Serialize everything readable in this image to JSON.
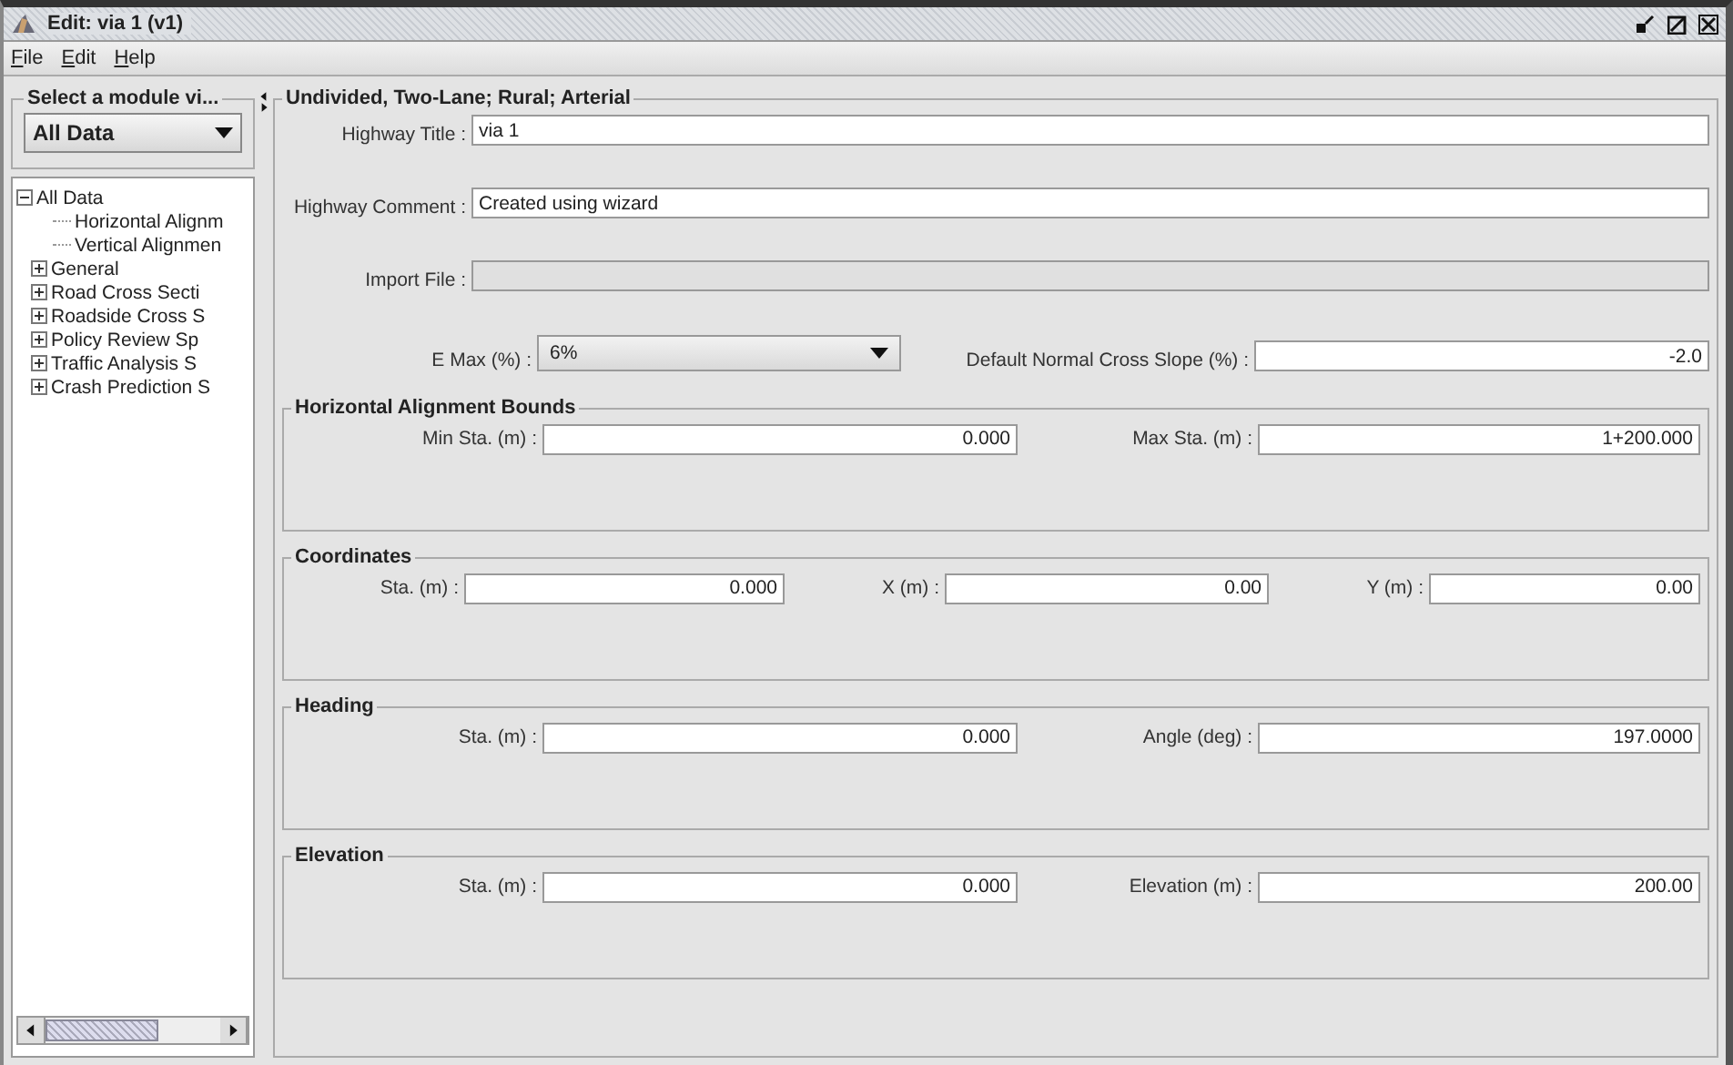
{
  "window": {
    "title": "Edit: via 1 (v1)"
  },
  "menu": [
    "File",
    "Edit",
    "Help"
  ],
  "module_selector": {
    "title": "Select a module vi...",
    "value": "All Data"
  },
  "tree": [
    {
      "label": "All Data",
      "expanded": true,
      "children": [
        {
          "label": "Horizontal Alignm"
        },
        {
          "label": "Vertical Alignmen"
        },
        {
          "label": "General",
          "expanded": false
        },
        {
          "label": "Road Cross Secti",
          "expanded": false
        },
        {
          "label": "Roadside Cross S",
          "expanded": false
        },
        {
          "label": "Policy Review Sp",
          "expanded": false
        },
        {
          "label": "Traffic Analysis S",
          "expanded": false
        },
        {
          "label": "Crash Prediction S",
          "expanded": false
        }
      ]
    }
  ],
  "highway": {
    "title": "Undivided, Two-Lane; Rural; Arterial",
    "fields": [
      {
        "label": "Highway Title :",
        "value": "via 1",
        "disabled": false
      },
      {
        "label": "Highway Comment :",
        "value": "Created using wizard",
        "disabled": false
      },
      {
        "label": "Import File :",
        "disabled": true
      }
    ],
    "e_max": {
      "label": "E Max (%) :",
      "value": "6%"
    },
    "cross_slope": {
      "label": "Default Normal Cross Slope (%) :",
      "value": "-2.0"
    }
  },
  "sections": [
    {
      "title": "Horizontal Alignment Bounds",
      "fields": [
        {
          "label": "Min Sta. (m) :",
          "value": "0.000"
        },
        {
          "label": "Max Sta. (m) :",
          "value": "1+200.000"
        }
      ]
    },
    {
      "title": "Coordinates",
      "fields": [
        {
          "label": "Sta. (m) :",
          "value": "0.000"
        },
        {
          "label": "X (m) :",
          "value": "0.00"
        },
        {
          "label": "Y (m) :",
          "value": "0.00"
        }
      ]
    },
    {
      "title": "Heading",
      "fields": [
        {
          "label": "Sta. (m) :",
          "value": "0.000"
        },
        {
          "label": "Angle (deg) :",
          "value": "197.0000"
        }
      ]
    },
    {
      "title": "Elevation",
      "fields": [
        {
          "label": "Sta. (m) :",
          "value": "0.000"
        },
        {
          "label": "Elevation (m) :",
          "value": "200.00"
        }
      ]
    }
  ]
}
